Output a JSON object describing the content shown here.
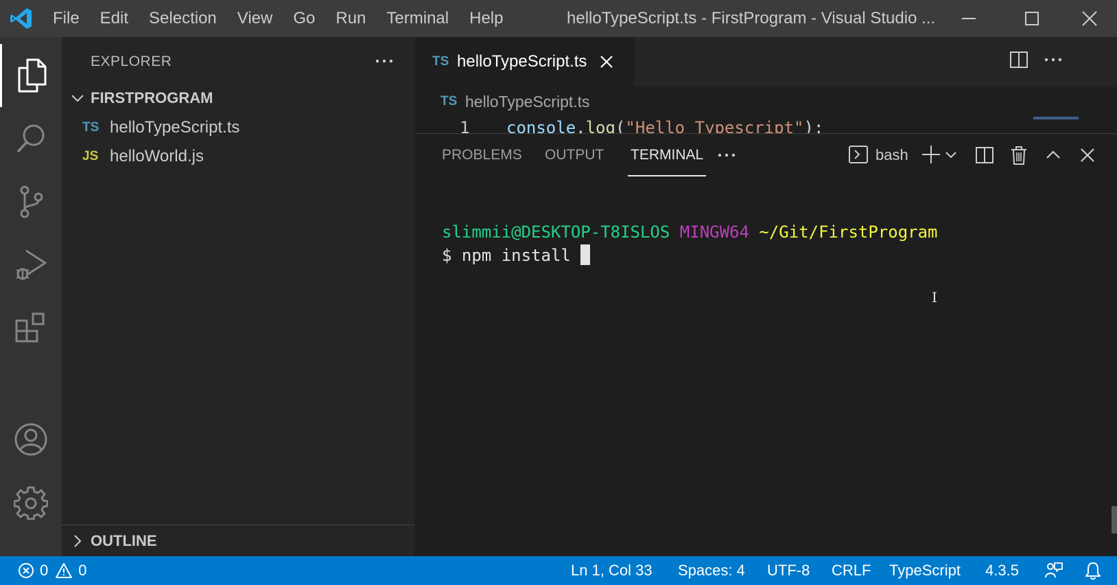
{
  "titlebar": {
    "menu": [
      "File",
      "Edit",
      "Selection",
      "View",
      "Go",
      "Run",
      "Terminal",
      "Help"
    ],
    "window_title": "helloTypeScript.ts - FirstProgram - Visual Studio ...",
    "brand_color": "#23a9f2"
  },
  "activitybar": {
    "items": [
      "files-icon",
      "search-icon",
      "source-control-icon",
      "run-debug-icon",
      "extensions-icon"
    ],
    "bottom_items": [
      "account-icon",
      "settings-gear-icon"
    ]
  },
  "sidebar": {
    "title": "EXPLORER",
    "folder": "FIRSTPROGRAM",
    "files": [
      {
        "badge": "TS",
        "name": "helloTypeScript.ts",
        "badge_color": "#519aba"
      },
      {
        "badge": "JS",
        "name": "helloWorld.js",
        "badge_color": "#cbcb41"
      }
    ],
    "outline": "OUTLINE"
  },
  "editor": {
    "tab": {
      "badge": "TS",
      "name": "helloTypeScript.ts"
    },
    "breadcrumb": {
      "badge": "TS",
      "name": "helloTypeScript.ts"
    },
    "line_number": "1",
    "code": {
      "fn": "console",
      "dot": ".",
      "method": "log",
      "open": "(",
      "str": "\"Hello Typescript\"",
      "close": ");"
    }
  },
  "panel": {
    "tabs": [
      "PROBLEMS",
      "OUTPUT",
      "TERMINAL"
    ],
    "active_tab": "TERMINAL",
    "shell": "bash"
  },
  "terminal": {
    "user_host": "slimmii@DESKTOP-T8ISLOS",
    "env": "MINGW64",
    "path": "~/Git/FirstProgram",
    "prompt": "$ ",
    "command": "npm install "
  },
  "statusbar": {
    "errors": "0",
    "warnings": "0",
    "position": "Ln 1, Col 33",
    "spaces": "Spaces: 4",
    "encoding": "UTF-8",
    "eol": "CRLF",
    "language": "TypeScript",
    "version": "4.3.5",
    "bg_color": "#007acc"
  }
}
